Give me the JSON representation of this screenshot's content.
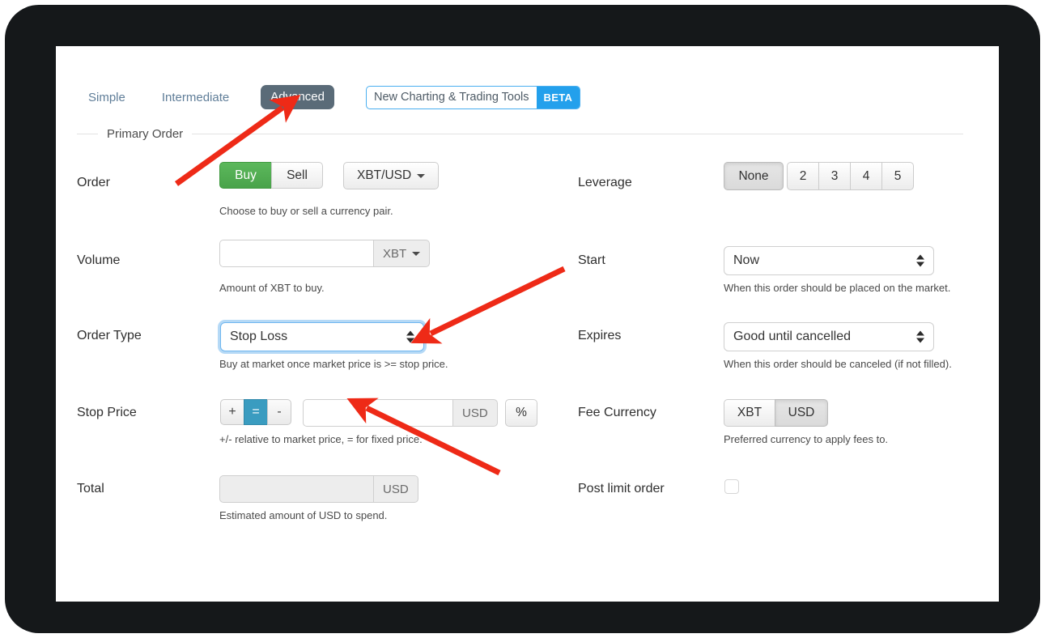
{
  "tabs": [
    {
      "label": "Simple",
      "state": "link"
    },
    {
      "label": "Intermediate",
      "state": "link"
    },
    {
      "label": "Advanced",
      "state": "selected"
    }
  ],
  "beta_banner": {
    "text": "New Charting & Trading Tools",
    "badge": "BETA"
  },
  "fieldset": {
    "legend": "Primary Order"
  },
  "fields": {
    "order": {
      "label": "Order",
      "buy_label": "Buy",
      "sell_label": "Sell",
      "selected_side": "Buy",
      "pair": "XBT/USD",
      "help": "Choose to buy or sell a currency pair."
    },
    "leverage": {
      "label": "Leverage",
      "options": [
        "None",
        "2",
        "3",
        "4",
        "5"
      ],
      "selected": "None"
    },
    "volume": {
      "label": "Volume",
      "value": "",
      "placeholder": "",
      "unit": "XBT",
      "help": "Amount of XBT to buy."
    },
    "start": {
      "label": "Start",
      "value": "Now",
      "help": "When this order should be placed on the market."
    },
    "order_type": {
      "label": "Order Type",
      "value": "Stop Loss",
      "focused": true,
      "help": "Buy at market once market price is >= stop price."
    },
    "expires": {
      "label": "Expires",
      "value": "Good until cancelled",
      "help": "When this order should be canceled (if not filled)."
    },
    "stop_price": {
      "label": "Stop Price",
      "signs": [
        "+",
        "=",
        "-"
      ],
      "selected_sign": "=",
      "value": "",
      "placeholder": "",
      "unit": "USD",
      "percent_label": "%",
      "help": "+/- relative to market price, = for fixed price."
    },
    "fee_currency": {
      "label": "Fee Currency",
      "options": [
        "XBT",
        "USD"
      ],
      "selected": "USD",
      "help": "Preferred currency to apply fees to."
    },
    "total": {
      "label": "Total",
      "value": "",
      "unit": "USD",
      "disabled": true,
      "help": "Estimated amount of USD to spend."
    },
    "post_limit_order": {
      "label": "Post limit order",
      "checked": false
    }
  },
  "colors": {
    "buy_green": "#4faf4f",
    "tab_active": "#5a6b78",
    "beta_blue": "#23a0ec",
    "link_blue": "#5f7d98",
    "sign_selected": "#3a9cc0",
    "focus_blue": "#6fb6ef",
    "annotation_red": "#ee2a17",
    "bezel": "#15181a"
  },
  "annotations": [
    {
      "name": "arrow-to-advanced-tab",
      "from": [
        218,
        227
      ],
      "to": [
        349,
        133
      ]
    },
    {
      "name": "arrow-to-order-type-select",
      "from": [
        697,
        332
      ],
      "to": [
        532,
        412
      ]
    },
    {
      "name": "arrow-to-stop-price-input",
      "from": [
        617,
        584
      ],
      "to": [
        453,
        504
      ]
    }
  ]
}
